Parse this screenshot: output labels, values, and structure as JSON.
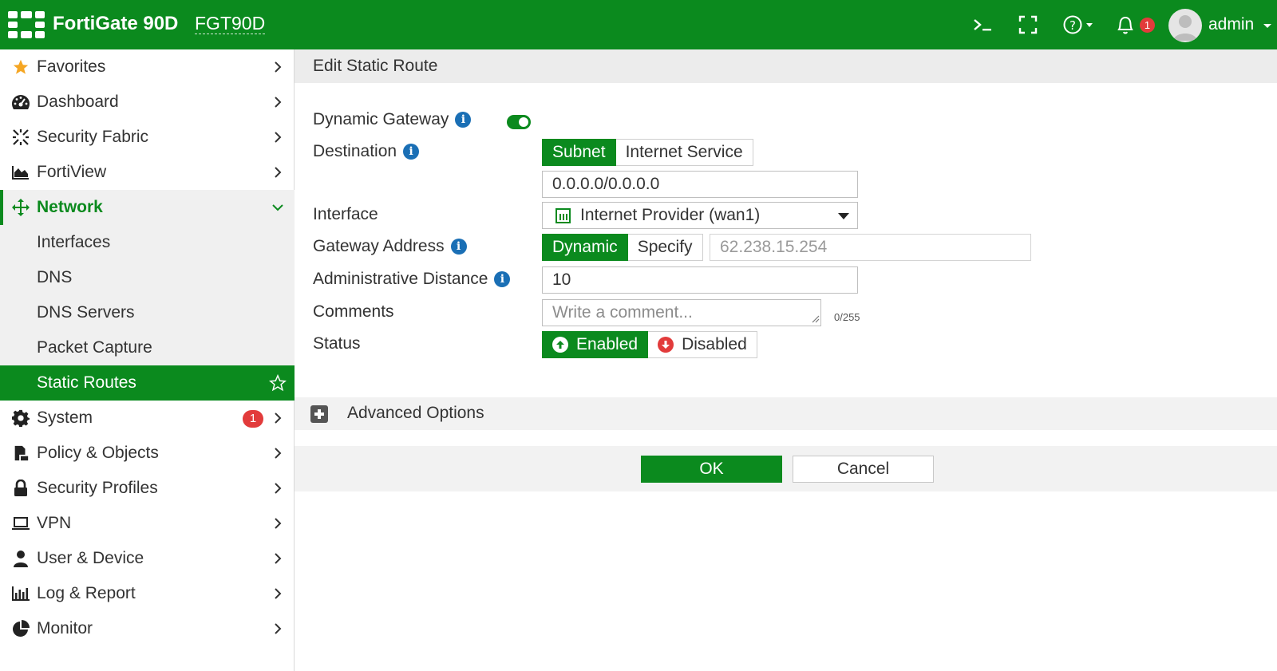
{
  "header": {
    "brand": "FortiGate 90D",
    "hostname": "FGT90D",
    "notification_count": "1",
    "user": "admin",
    "colors": {
      "brand_green": "#0b8a1e",
      "badge_red": "#e23b3b"
    },
    "icons": [
      "cli-console-icon",
      "fullscreen-icon",
      "help-icon",
      "bell-icon",
      "user-avatar-icon"
    ]
  },
  "sidebar": {
    "items": [
      {
        "label": "Favorites",
        "icon": "star-icon"
      },
      {
        "label": "Dashboard",
        "icon": "dashboard-icon"
      },
      {
        "label": "Security Fabric",
        "icon": "security-fabric-icon"
      },
      {
        "label": "FortiView",
        "icon": "area-chart-icon"
      },
      {
        "label": "Network",
        "icon": "network-icon",
        "expanded": true
      },
      {
        "label": "Interfaces"
      },
      {
        "label": "DNS"
      },
      {
        "label": "DNS Servers"
      },
      {
        "label": "Packet Capture"
      },
      {
        "label": "Static Routes",
        "active": true
      },
      {
        "label": "System",
        "icon": "gear-icon",
        "badge": "1"
      },
      {
        "label": "Policy & Objects",
        "icon": "policy-icon"
      },
      {
        "label": "Security Profiles",
        "icon": "lock-icon"
      },
      {
        "label": "VPN",
        "icon": "laptop-icon"
      },
      {
        "label": "User & Device",
        "icon": "user-icon"
      },
      {
        "label": "Log & Report",
        "icon": "bar-chart-icon"
      },
      {
        "label": "Monitor",
        "icon": "pie-chart-icon"
      }
    ]
  },
  "form": {
    "title": "Edit Static Route",
    "dynamic_gateway": {
      "label": "Dynamic Gateway",
      "enabled": true
    },
    "destination": {
      "label": "Destination",
      "options": [
        "Subnet",
        "Internet Service"
      ],
      "selected": "Subnet",
      "value": "0.0.0.0/0.0.0.0"
    },
    "interface": {
      "label": "Interface",
      "value": "Internet Provider (wan1)"
    },
    "gateway_address": {
      "label": "Gateway Address",
      "options": [
        "Dynamic",
        "Specify"
      ],
      "selected": "Dynamic",
      "value": "62.238.15.254"
    },
    "admin_distance": {
      "label": "Administrative Distance",
      "value": "10"
    },
    "comments": {
      "label": "Comments",
      "placeholder": "Write a comment...",
      "counter": "0/255"
    },
    "status": {
      "label": "Status",
      "options": [
        "Enabled",
        "Disabled"
      ],
      "selected": "Enabled"
    },
    "advanced": "Advanced Options",
    "ok": "OK",
    "cancel": "Cancel"
  }
}
